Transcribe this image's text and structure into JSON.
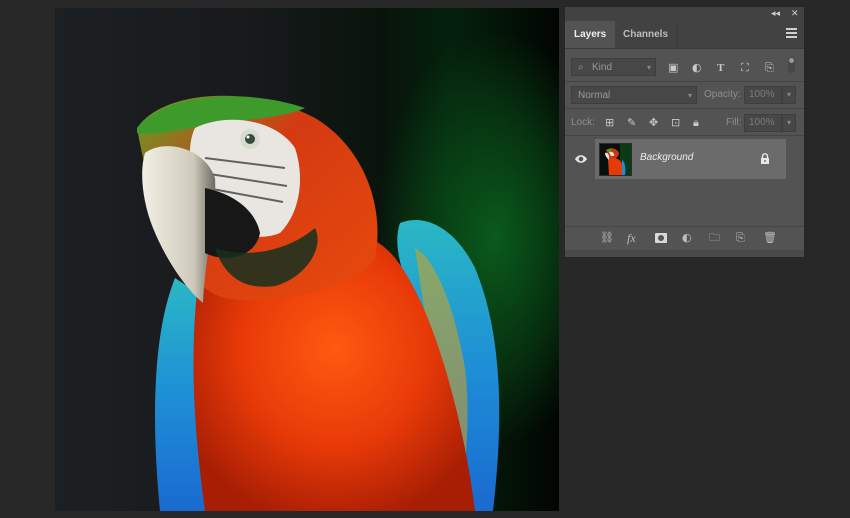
{
  "panel": {
    "collapse_icon": "double-chevron-icon",
    "close_icon": "close-icon",
    "tabs": [
      {
        "label": "Layers",
        "active": true
      },
      {
        "label": "Channels",
        "active": false
      }
    ],
    "menu_icon": "panel-menu-icon"
  },
  "filter": {
    "kind_label": "Kind",
    "icons": [
      "image-filter-icon",
      "adjustment-filter-icon",
      "type-filter-icon",
      "shape-filter-icon",
      "smart-object-filter-icon",
      "filter-toggle-icon"
    ]
  },
  "blend": {
    "mode": "Normal",
    "opacity_label": "Opacity:",
    "opacity_value": "100%"
  },
  "lock": {
    "label": "Lock:",
    "icons": [
      "lock-transparency-icon",
      "lock-image-icon",
      "lock-position-icon",
      "lock-artboard-icon",
      "lock-all-icon"
    ],
    "fill_label": "Fill:",
    "fill_value": "100%"
  },
  "layers": [
    {
      "name": "Background",
      "visible": true,
      "locked": true
    }
  ],
  "footer_icons": [
    "link-layers-icon",
    "fx-icon",
    "add-mask-icon",
    "adjustment-layer-icon",
    "new-group-icon",
    "new-layer-icon",
    "delete-layer-icon"
  ],
  "colors": {
    "panel_bg": "#535353",
    "tab_bar": "#424242",
    "selected_layer": "#6b6b6b",
    "app_bg": "#282828"
  }
}
